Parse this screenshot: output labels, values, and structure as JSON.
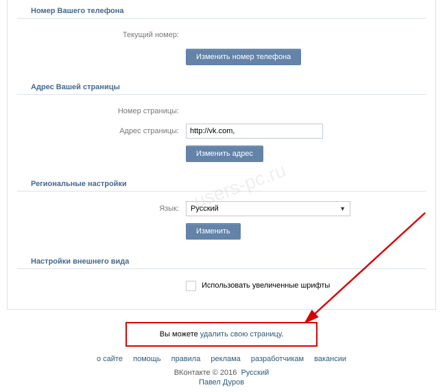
{
  "sections": {
    "phone": {
      "title": "Номер Вашего телефона",
      "currentLabel": "Текущий номер:",
      "currentValue": "",
      "changeBtn": "Изменить номер телефона"
    },
    "address": {
      "title": "Адрес Вашей страницы",
      "pageNumberLabel": "Номер страницы:",
      "pageNumberValue": "",
      "pageAddressLabel": "Адрес страницы:",
      "pageAddressValue": "http://vk.com,",
      "changeBtn": "Изменить адрес"
    },
    "regional": {
      "title": "Региональные настройки",
      "langLabel": "Язык:",
      "langValue": "Русский",
      "changeBtn": "Изменить"
    },
    "appearance": {
      "title": "Настройки внешнего вида",
      "checkboxLabel": "Использовать увеличенные шрифты"
    }
  },
  "delete": {
    "prefix": "Вы можете ",
    "link": "удалить свою страницу",
    "suffix": "."
  },
  "footer": {
    "links": [
      "о сайте",
      "помощь",
      "правила",
      "реклама",
      "разработчикам",
      "вакансии"
    ],
    "brand": "ВКонтакте",
    "copy": "© 2016",
    "lang": "Русский",
    "author": "Павел Дуров"
  },
  "watermark": "users-pc.ru"
}
